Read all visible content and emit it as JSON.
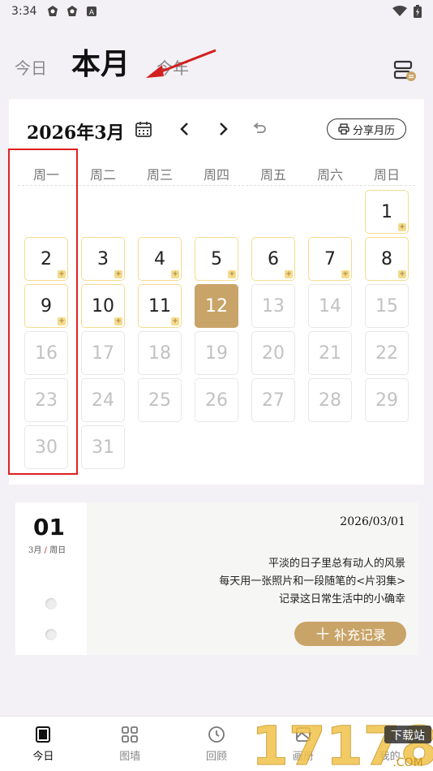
{
  "status_bar": {
    "time": "3:34",
    "icons": [
      "bug-icon",
      "bug-icon",
      "a-letter-icon"
    ],
    "right_icons": [
      "wifi-icon",
      "battery-icon"
    ]
  },
  "view_tabs": {
    "today": "今日",
    "month": "本月",
    "year": "今年",
    "active": "month"
  },
  "calendar": {
    "title": "2026年3月",
    "share_label": "分享月历",
    "weekdays": [
      "周一",
      "周二",
      "周三",
      "周四",
      "周五",
      "周六",
      "周日"
    ],
    "recorded_days": [
      1,
      2,
      3,
      4,
      5,
      6,
      7,
      8,
      9,
      10,
      11
    ],
    "today": 12,
    "first_weekday_index": 6,
    "days_in_month": 31
  },
  "entry": {
    "day": "01",
    "month": "3月",
    "weekday": "周日",
    "date": "2026/03/01",
    "lines": [
      "平淡的日子里总有动人的风景",
      "每天用一张照片和一段随笔的<片羽集>",
      "记录这日常生活中的小确幸"
    ],
    "add_label": "补充记录"
  },
  "bottom_nav": [
    {
      "label": "今日",
      "icon": "today-icon",
      "active": true
    },
    {
      "label": "图墙",
      "icon": "grid-icon",
      "active": false
    },
    {
      "label": "回顾",
      "icon": "history-icon",
      "active": false
    },
    {
      "label": "画册",
      "icon": "album-icon",
      "active": false
    },
    {
      "label": "我的",
      "icon": "profile-icon",
      "active": false
    }
  ],
  "colors": {
    "accent": "#c9a468",
    "record_border": "#f4dc8e",
    "annotation_red": "#e02020"
  }
}
